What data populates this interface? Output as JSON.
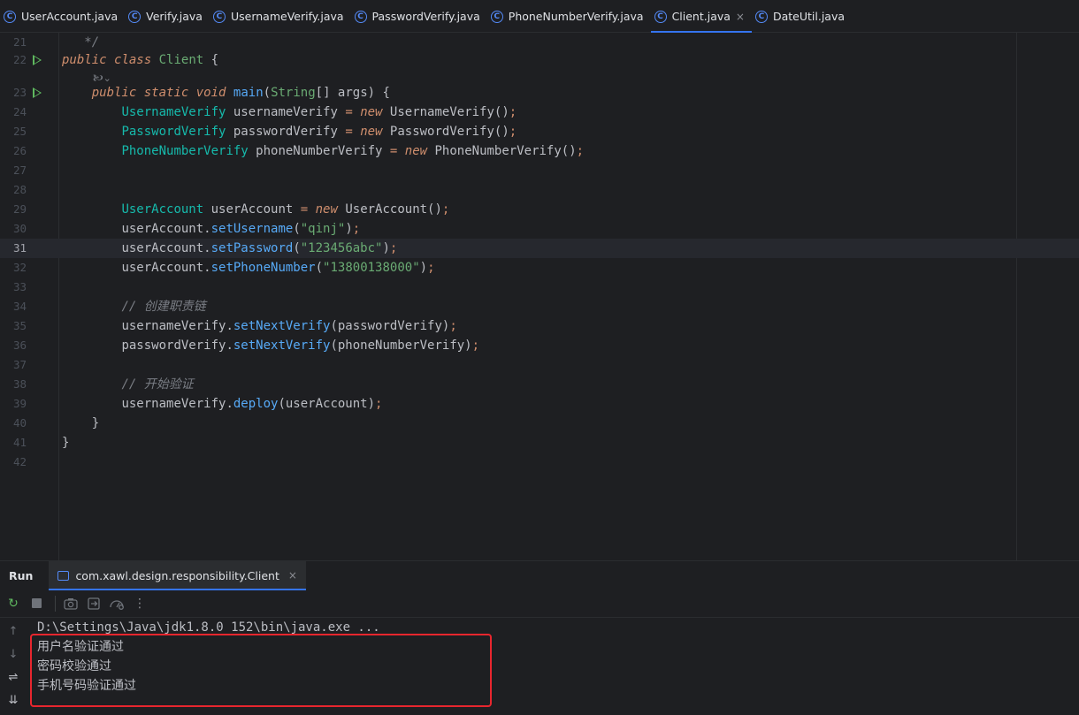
{
  "tabs": [
    {
      "label": "UserAccount.java",
      "icon": "class-icon",
      "active": false
    },
    {
      "label": "Verify.java",
      "icon": "class-icon",
      "active": false
    },
    {
      "label": "UsernameVerify.java",
      "icon": "class-icon",
      "active": false
    },
    {
      "label": "PasswordVerify.java",
      "icon": "class-icon",
      "active": false
    },
    {
      "label": "PhoneNumberVerify.java",
      "icon": "class-icon",
      "active": false
    },
    {
      "label": "Client.java",
      "icon": "class-icon",
      "active": true
    },
    {
      "label": "DateUtil.java",
      "icon": "class-icon",
      "active": false
    }
  ],
  "tab_close_glyph": "×",
  "class_icon_glyph": "C",
  "editor": {
    "current_line": 31,
    "hint_text": "🙤⌄",
    "lines": [
      {
        "n": "21",
        "tokens": [
          [
            "cmt",
            "   */"
          ]
        ]
      },
      {
        "n": "22",
        "run": true,
        "tokens": [
          [
            "kw",
            "public"
          ],
          [
            "punct",
            " "
          ],
          [
            "kw",
            "class"
          ],
          [
            "punct",
            " "
          ],
          [
            "cls",
            "Client"
          ],
          [
            "punct",
            " {"
          ]
        ]
      },
      {
        "n": "23",
        "run": true,
        "tokens": [
          [
            "punct",
            "    "
          ],
          [
            "kw",
            "public"
          ],
          [
            "punct",
            " "
          ],
          [
            "kw",
            "static"
          ],
          [
            "punct",
            " "
          ],
          [
            "kw",
            "void"
          ],
          [
            "punct",
            " "
          ],
          [
            "method",
            "main"
          ],
          [
            "punct",
            "("
          ],
          [
            "cls",
            "String"
          ],
          [
            "punct",
            "[] args) {"
          ]
        ]
      },
      {
        "n": "24",
        "tokens": [
          [
            "punct",
            "        "
          ],
          [
            "tname",
            "UsernameVerify"
          ],
          [
            "ident",
            " usernameVerify "
          ],
          [
            "kw2",
            "="
          ],
          [
            "punct",
            " "
          ],
          [
            "kw",
            "new"
          ],
          [
            "ident",
            " UsernameVerify()"
          ],
          [
            "semi",
            ";"
          ]
        ]
      },
      {
        "n": "25",
        "tokens": [
          [
            "punct",
            "        "
          ],
          [
            "tname",
            "PasswordVerify"
          ],
          [
            "ident",
            " passwordVerify "
          ],
          [
            "kw2",
            "="
          ],
          [
            "punct",
            " "
          ],
          [
            "kw",
            "new"
          ],
          [
            "ident",
            " PasswordVerify()"
          ],
          [
            "semi",
            ";"
          ]
        ]
      },
      {
        "n": "26",
        "tokens": [
          [
            "punct",
            "        "
          ],
          [
            "tname",
            "PhoneNumberVerify"
          ],
          [
            "ident",
            " phoneNumberVerify "
          ],
          [
            "kw2",
            "="
          ],
          [
            "punct",
            " "
          ],
          [
            "kw",
            "new"
          ],
          [
            "ident",
            " PhoneNumberVerify()"
          ],
          [
            "semi",
            ";"
          ]
        ]
      },
      {
        "n": "27",
        "tokens": []
      },
      {
        "n": "28",
        "tokens": []
      },
      {
        "n": "29",
        "tokens": [
          [
            "punct",
            "        "
          ],
          [
            "tname",
            "UserAccount"
          ],
          [
            "ident",
            " userAccount "
          ],
          [
            "kw2",
            "="
          ],
          [
            "punct",
            " "
          ],
          [
            "kw",
            "new"
          ],
          [
            "ident",
            " UserAccount()"
          ],
          [
            "semi",
            ";"
          ]
        ]
      },
      {
        "n": "30",
        "tokens": [
          [
            "punct",
            "        "
          ],
          [
            "ident",
            "userAccount."
          ],
          [
            "call",
            "setUsername"
          ],
          [
            "ident",
            "("
          ],
          [
            "str",
            "\"qinj\""
          ],
          [
            "ident",
            ")"
          ],
          [
            "semi",
            ";"
          ]
        ]
      },
      {
        "n": "31",
        "tokens": [
          [
            "punct",
            "        "
          ],
          [
            "ident",
            "userAccount."
          ],
          [
            "call",
            "setPassword"
          ],
          [
            "ident",
            "("
          ],
          [
            "str",
            "\"123456abc\""
          ],
          [
            "ident",
            ")"
          ],
          [
            "semi",
            ";"
          ]
        ]
      },
      {
        "n": "32",
        "tokens": [
          [
            "punct",
            "        "
          ],
          [
            "ident",
            "userAccount."
          ],
          [
            "call",
            "setPhoneNumber"
          ],
          [
            "ident",
            "("
          ],
          [
            "str",
            "\"13800138000\""
          ],
          [
            "ident",
            ")"
          ],
          [
            "semi",
            ";"
          ]
        ]
      },
      {
        "n": "33",
        "tokens": []
      },
      {
        "n": "34",
        "tokens": [
          [
            "punct",
            "        "
          ],
          [
            "cmt",
            "// 创建职责链"
          ]
        ]
      },
      {
        "n": "35",
        "tokens": [
          [
            "punct",
            "        "
          ],
          [
            "ident",
            "usernameVerify."
          ],
          [
            "call",
            "setNextVerify"
          ],
          [
            "ident",
            "(passwordVerify)"
          ],
          [
            "semi",
            ";"
          ]
        ]
      },
      {
        "n": "36",
        "tokens": [
          [
            "punct",
            "        "
          ],
          [
            "ident",
            "passwordVerify."
          ],
          [
            "call",
            "setNextVerify"
          ],
          [
            "ident",
            "(phoneNumberVerify)"
          ],
          [
            "semi",
            ";"
          ]
        ]
      },
      {
        "n": "37",
        "tokens": []
      },
      {
        "n": "38",
        "tokens": [
          [
            "punct",
            "        "
          ],
          [
            "cmt",
            "// 开始验证"
          ]
        ]
      },
      {
        "n": "39",
        "tokens": [
          [
            "punct",
            "        "
          ],
          [
            "ident",
            "usernameVerify."
          ],
          [
            "call",
            "deploy"
          ],
          [
            "ident",
            "(userAccount)"
          ],
          [
            "semi",
            ";"
          ]
        ]
      },
      {
        "n": "40",
        "tokens": [
          [
            "punct",
            "    }"
          ]
        ]
      },
      {
        "n": "41",
        "tokens": [
          [
            "punct",
            "}"
          ]
        ]
      },
      {
        "n": "42",
        "tokens": []
      }
    ]
  },
  "run_panel": {
    "title": "Run",
    "tab_label": "com.xawl.design.responsibility.Client",
    "console": {
      "command": "D:\\Settings\\Java\\jdk1.8.0_152\\bin\\java.exe ...",
      "output": [
        "用户名验证通过",
        "密码校验通过",
        "手机号码验证通过"
      ]
    }
  },
  "toolbar_glyphs": {
    "rerun": "↻",
    "more": "⋮"
  },
  "side_glyphs": {
    "up": "↑",
    "down": "↓",
    "wrap": "⇌",
    "scroll_end": "⇊"
  },
  "colors": {
    "accent": "#3574f0",
    "highlight_border": "#e8262e",
    "run_green": "#5fb85f"
  }
}
